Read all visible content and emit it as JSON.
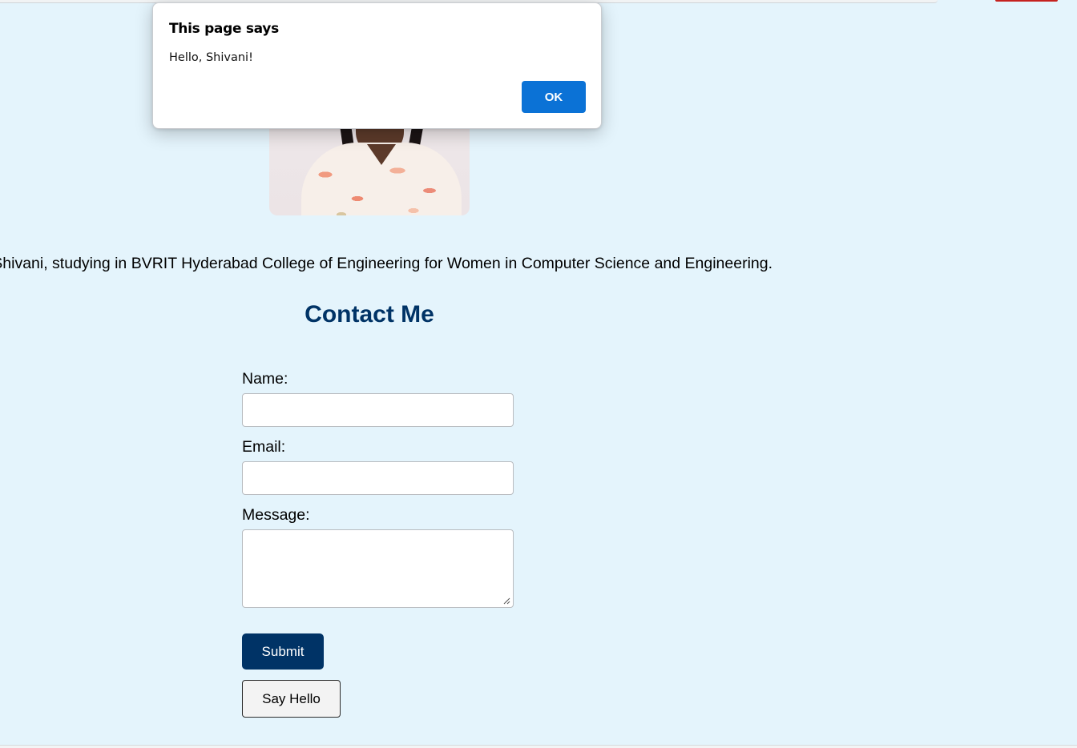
{
  "intro": {
    "text": "e Shivani, studying in BVRIT Hyderabad College of Engineering for Women in Computer Science and Engineering."
  },
  "contact": {
    "heading": "Contact Me",
    "name_label": "Name:",
    "name_value": "",
    "email_label": "Email:",
    "email_value": "",
    "message_label": "Message:",
    "message_value": "",
    "submit_label": "Submit",
    "say_hello_label": "Say Hello"
  },
  "dialog": {
    "title": "This page says",
    "message": "Hello, Shivani!",
    "ok_label": "OK"
  },
  "colors": {
    "page_background": "#e4f4fc",
    "heading": "#003366",
    "submit_button": "#003366",
    "dialog_ok_button": "#0b72d6"
  },
  "icons": {
    "textarea_resize": "resize-grip-icon"
  }
}
